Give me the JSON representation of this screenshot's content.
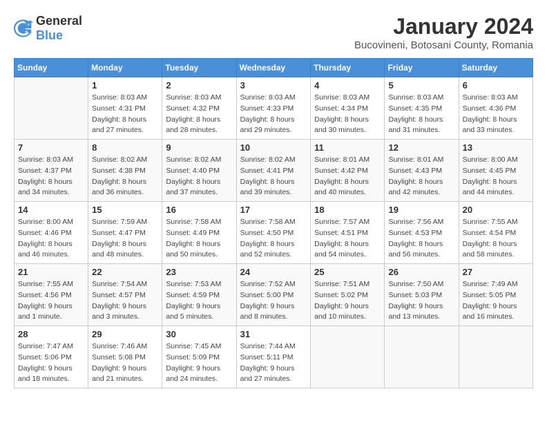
{
  "logo": {
    "general": "General",
    "blue": "Blue"
  },
  "header": {
    "month": "January 2024",
    "location": "Bucovineni, Botosani County, Romania"
  },
  "weekdays": [
    "Sunday",
    "Monday",
    "Tuesday",
    "Wednesday",
    "Thursday",
    "Friday",
    "Saturday"
  ],
  "weeks": [
    [
      {
        "day": "",
        "sunrise": "",
        "sunset": "",
        "daylight": ""
      },
      {
        "day": "1",
        "sunrise": "Sunrise: 8:03 AM",
        "sunset": "Sunset: 4:31 PM",
        "daylight": "Daylight: 8 hours and 27 minutes."
      },
      {
        "day": "2",
        "sunrise": "Sunrise: 8:03 AM",
        "sunset": "Sunset: 4:32 PM",
        "daylight": "Daylight: 8 hours and 28 minutes."
      },
      {
        "day": "3",
        "sunrise": "Sunrise: 8:03 AM",
        "sunset": "Sunset: 4:33 PM",
        "daylight": "Daylight: 8 hours and 29 minutes."
      },
      {
        "day": "4",
        "sunrise": "Sunrise: 8:03 AM",
        "sunset": "Sunset: 4:34 PM",
        "daylight": "Daylight: 8 hours and 30 minutes."
      },
      {
        "day": "5",
        "sunrise": "Sunrise: 8:03 AM",
        "sunset": "Sunset: 4:35 PM",
        "daylight": "Daylight: 8 hours and 31 minutes."
      },
      {
        "day": "6",
        "sunrise": "Sunrise: 8:03 AM",
        "sunset": "Sunset: 4:36 PM",
        "daylight": "Daylight: 8 hours and 33 minutes."
      }
    ],
    [
      {
        "day": "7",
        "sunrise": "Sunrise: 8:03 AM",
        "sunset": "Sunset: 4:37 PM",
        "daylight": "Daylight: 8 hours and 34 minutes."
      },
      {
        "day": "8",
        "sunrise": "Sunrise: 8:02 AM",
        "sunset": "Sunset: 4:38 PM",
        "daylight": "Daylight: 8 hours and 36 minutes."
      },
      {
        "day": "9",
        "sunrise": "Sunrise: 8:02 AM",
        "sunset": "Sunset: 4:40 PM",
        "daylight": "Daylight: 8 hours and 37 minutes."
      },
      {
        "day": "10",
        "sunrise": "Sunrise: 8:02 AM",
        "sunset": "Sunset: 4:41 PM",
        "daylight": "Daylight: 8 hours and 39 minutes."
      },
      {
        "day": "11",
        "sunrise": "Sunrise: 8:01 AM",
        "sunset": "Sunset: 4:42 PM",
        "daylight": "Daylight: 8 hours and 40 minutes."
      },
      {
        "day": "12",
        "sunrise": "Sunrise: 8:01 AM",
        "sunset": "Sunset: 4:43 PM",
        "daylight": "Daylight: 8 hours and 42 minutes."
      },
      {
        "day": "13",
        "sunrise": "Sunrise: 8:00 AM",
        "sunset": "Sunset: 4:45 PM",
        "daylight": "Daylight: 8 hours and 44 minutes."
      }
    ],
    [
      {
        "day": "14",
        "sunrise": "Sunrise: 8:00 AM",
        "sunset": "Sunset: 4:46 PM",
        "daylight": "Daylight: 8 hours and 46 minutes."
      },
      {
        "day": "15",
        "sunrise": "Sunrise: 7:59 AM",
        "sunset": "Sunset: 4:47 PM",
        "daylight": "Daylight: 8 hours and 48 minutes."
      },
      {
        "day": "16",
        "sunrise": "Sunrise: 7:58 AM",
        "sunset": "Sunset: 4:49 PM",
        "daylight": "Daylight: 8 hours and 50 minutes."
      },
      {
        "day": "17",
        "sunrise": "Sunrise: 7:58 AM",
        "sunset": "Sunset: 4:50 PM",
        "daylight": "Daylight: 8 hours and 52 minutes."
      },
      {
        "day": "18",
        "sunrise": "Sunrise: 7:57 AM",
        "sunset": "Sunset: 4:51 PM",
        "daylight": "Daylight: 8 hours and 54 minutes."
      },
      {
        "day": "19",
        "sunrise": "Sunrise: 7:56 AM",
        "sunset": "Sunset: 4:53 PM",
        "daylight": "Daylight: 8 hours and 56 minutes."
      },
      {
        "day": "20",
        "sunrise": "Sunrise: 7:55 AM",
        "sunset": "Sunset: 4:54 PM",
        "daylight": "Daylight: 8 hours and 58 minutes."
      }
    ],
    [
      {
        "day": "21",
        "sunrise": "Sunrise: 7:55 AM",
        "sunset": "Sunset: 4:56 PM",
        "daylight": "Daylight: 9 hours and 1 minute."
      },
      {
        "day": "22",
        "sunrise": "Sunrise: 7:54 AM",
        "sunset": "Sunset: 4:57 PM",
        "daylight": "Daylight: 9 hours and 3 minutes."
      },
      {
        "day": "23",
        "sunrise": "Sunrise: 7:53 AM",
        "sunset": "Sunset: 4:59 PM",
        "daylight": "Daylight: 9 hours and 5 minutes."
      },
      {
        "day": "24",
        "sunrise": "Sunrise: 7:52 AM",
        "sunset": "Sunset: 5:00 PM",
        "daylight": "Daylight: 9 hours and 8 minutes."
      },
      {
        "day": "25",
        "sunrise": "Sunrise: 7:51 AM",
        "sunset": "Sunset: 5:02 PM",
        "daylight": "Daylight: 9 hours and 10 minutes."
      },
      {
        "day": "26",
        "sunrise": "Sunrise: 7:50 AM",
        "sunset": "Sunset: 5:03 PM",
        "daylight": "Daylight: 9 hours and 13 minutes."
      },
      {
        "day": "27",
        "sunrise": "Sunrise: 7:49 AM",
        "sunset": "Sunset: 5:05 PM",
        "daylight": "Daylight: 9 hours and 16 minutes."
      }
    ],
    [
      {
        "day": "28",
        "sunrise": "Sunrise: 7:47 AM",
        "sunset": "Sunset: 5:06 PM",
        "daylight": "Daylight: 9 hours and 18 minutes."
      },
      {
        "day": "29",
        "sunrise": "Sunrise: 7:46 AM",
        "sunset": "Sunset: 5:08 PM",
        "daylight": "Daylight: 9 hours and 21 minutes."
      },
      {
        "day": "30",
        "sunrise": "Sunrise: 7:45 AM",
        "sunset": "Sunset: 5:09 PM",
        "daylight": "Daylight: 9 hours and 24 minutes."
      },
      {
        "day": "31",
        "sunrise": "Sunrise: 7:44 AM",
        "sunset": "Sunset: 5:11 PM",
        "daylight": "Daylight: 9 hours and 27 minutes."
      },
      {
        "day": "",
        "sunrise": "",
        "sunset": "",
        "daylight": ""
      },
      {
        "day": "",
        "sunrise": "",
        "sunset": "",
        "daylight": ""
      },
      {
        "day": "",
        "sunrise": "",
        "sunset": "",
        "daylight": ""
      }
    ]
  ]
}
